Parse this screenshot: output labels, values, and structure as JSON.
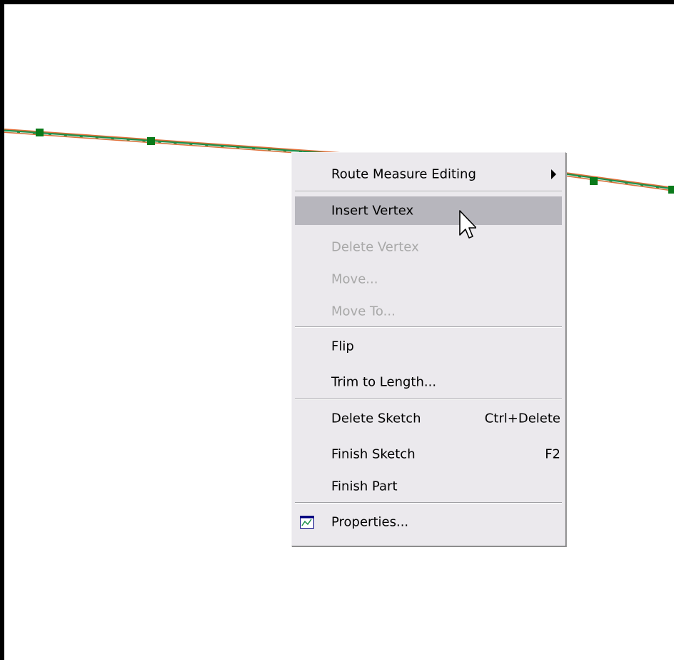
{
  "menu": {
    "items": [
      {
        "label": "Route Measure Editing",
        "shortcut": "",
        "submenu": true,
        "disabled": false,
        "highlighted": false
      },
      {
        "label": "Insert Vertex",
        "shortcut": "",
        "submenu": false,
        "disabled": false,
        "highlighted": true
      },
      {
        "label": "Delete Vertex",
        "shortcut": "",
        "submenu": false,
        "disabled": true,
        "highlighted": false
      },
      {
        "label": "Move...",
        "shortcut": "",
        "submenu": false,
        "disabled": true,
        "highlighted": false
      },
      {
        "label": "Move To...",
        "shortcut": "",
        "submenu": false,
        "disabled": true,
        "highlighted": false
      },
      {
        "label": "Flip",
        "shortcut": "",
        "submenu": false,
        "disabled": false,
        "highlighted": false
      },
      {
        "label": "Trim to Length...",
        "shortcut": "",
        "submenu": false,
        "disabled": false,
        "highlighted": false
      },
      {
        "label": "Delete Sketch",
        "shortcut": "Ctrl+Delete",
        "submenu": false,
        "disabled": false,
        "highlighted": false
      },
      {
        "label": "Finish Sketch",
        "shortcut": "F2",
        "submenu": false,
        "disabled": false,
        "highlighted": false
      },
      {
        "label": "Finish Part",
        "shortcut": "",
        "submenu": false,
        "disabled": false,
        "highlighted": false
      },
      {
        "label": "Properties...",
        "shortcut": "",
        "submenu": false,
        "disabled": false,
        "highlighted": false,
        "icon": "properties-icon"
      }
    ]
  },
  "colors": {
    "menu_background": "#ebe9ed",
    "highlight": "#b7b6bd",
    "disabled_text": "#a8a8a8",
    "sketch_line": "#1b8f4a",
    "sketch_line_secondary": "#e0703a",
    "vertex": "#0a7a1a"
  }
}
